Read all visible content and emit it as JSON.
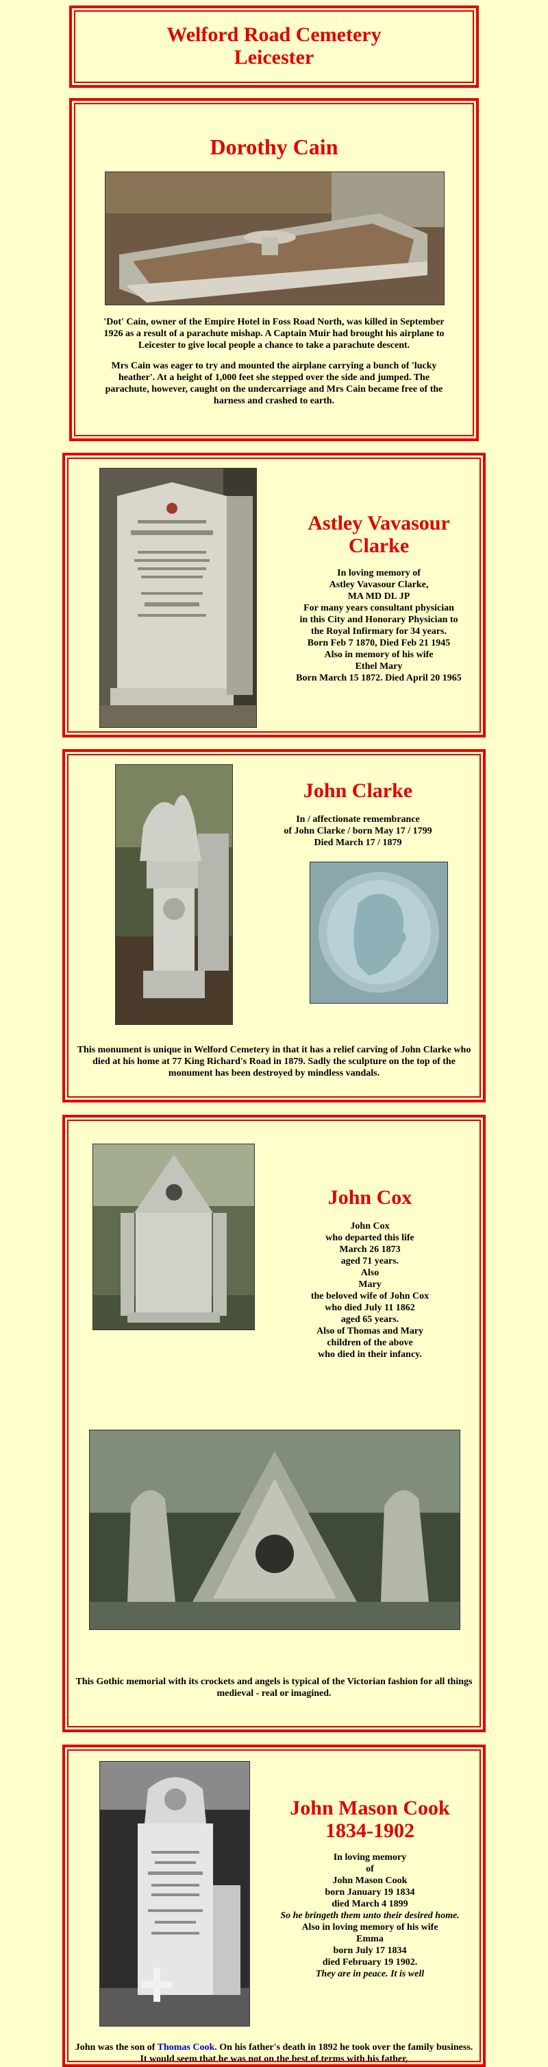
{
  "header": {
    "line1": "Welford Road Cemetery",
    "line2": "Leicester"
  },
  "cain": {
    "name": "Dorothy Cain",
    "p1": "'Dot' Cain, owner of the Empire Hotel in Foss Road North, was killed in September 1926 as a result of a parachute mishap. A Captain Muir had brought his airplane to Leicester to give local people a chance to take a parachute descent.",
    "p2": "Mrs Cain was eager to try and mounted the airplane carrying a bunch of 'lucky heather'. At a height of 1,000 feet she stepped over the side and jumped. The parachute, however, caught on the undercarriage and Mrs Cain became free of the harness and crashed to earth."
  },
  "astley": {
    "name1": "Astley Vavasour",
    "name2": "Clarke",
    "lines": [
      "In loving memory of",
      "Astley Vavasour Clarke,",
      "MA MD DL JP",
      "For many years consultant physician",
      "in this City and Honorary Physician to",
      "the Royal Infirmary for 34 years.",
      "Born Feb 7 1870, Died Feb 21 1945",
      "Also in memory of his wife",
      "Ethel Mary",
      "Born March 15 1872. Died April 20 1965"
    ]
  },
  "jclarke": {
    "name": "John Clarke",
    "lines": [
      "In / affectionate remembrance",
      "of John Clarke / born May 17 / 1799",
      "Died March 17 / 1879"
    ],
    "caption": "This monument is unique in Welford Cemetery in that it has a relief carving of John Clarke who died at his home at 77 King Richard's Road in 1879. Sadly the sculpture on the top of the monument has been destroyed by mindless vandals."
  },
  "cox": {
    "name": "John Cox",
    "lines": [
      "John Cox",
      "who departed this life",
      "March 26 1873",
      "aged 71 years.",
      "Also",
      "Mary",
      "the beloved wife of John Cox",
      "who died July 11 1862",
      "aged 65 years.",
      "Also of Thomas and Mary",
      "children of the above",
      "who died in their infancy."
    ],
    "caption": "This Gothic memorial with its crockets and angels is typical of the Victorian fashion for all things medieval - real or imagined."
  },
  "cook": {
    "name": "John Mason Cook",
    "years": "1834-1902",
    "lines": [
      "In loving memory",
      "of",
      "John Mason Cook",
      "born January 19 1834",
      "died March 4 1899"
    ],
    "verse1": "So he bringeth them unto their desired home.",
    "lines2": [
      "Also in loving memory of his wife",
      "Emma",
      "born July 17 1834",
      "died February 19 1902."
    ],
    "verse2": "They are in peace. It is well",
    "bio_pre": "John was the son of ",
    "bio_link": "Thomas Cook",
    "bio_post": ". On his father's death in 1892 he took over the family business. It would seem that he was not on the best of terms with his father,"
  },
  "colors": {
    "accent": "#e00000",
    "bg": "#ffffcc",
    "link": "#0000cc"
  }
}
